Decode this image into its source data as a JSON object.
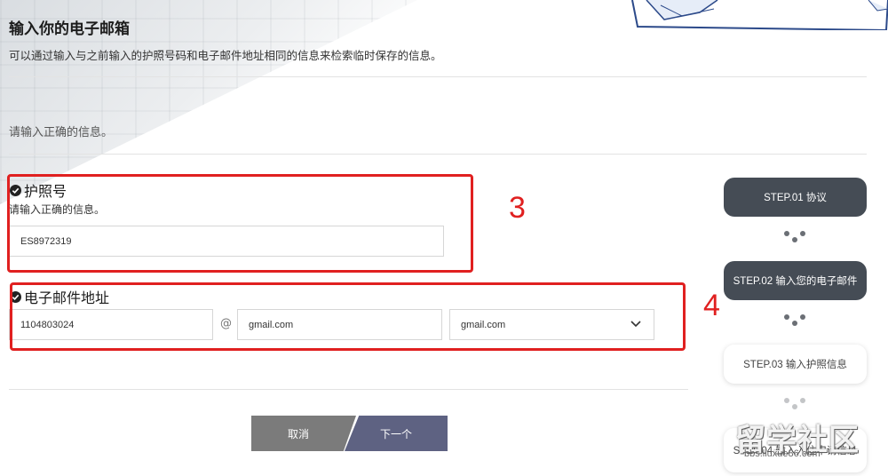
{
  "header": {
    "title": "输入你的电子邮箱",
    "description": "可以通过输入与之前输入的护照号码和电子邮件地址相同的信息来检索临时保存的信息。",
    "hint": "请输入正确的信息。"
  },
  "passport": {
    "label": "护照号",
    "sublabel": "请输入正确的信息。",
    "value": "ES8972319"
  },
  "email": {
    "label": "电子邮件地址",
    "local_part": "1104803024",
    "at": "@",
    "domain": "gmail.com",
    "domain_select": "gmail.com"
  },
  "annotations": [
    "3",
    "4"
  ],
  "buttons": {
    "cancel": "取消",
    "next": "下一个"
  },
  "steps": [
    {
      "label": "STEP.01 协议",
      "state": "active"
    },
    {
      "label": "STEP.02 输入您的电子邮件",
      "state": "active"
    },
    {
      "label": "STEP.03 输入护照信息",
      "state": "inactive"
    },
    {
      "label": "STEP.04 输入入住申请信息",
      "state": "inactive"
    }
  ],
  "watermark": {
    "text": "留学社区",
    "url": "bbs.liuxue86.com"
  },
  "colors": {
    "accent": "#454c55",
    "annotation": "#e02020",
    "next_button": "#5e6282",
    "cancel_button": "#7b7b7b"
  },
  "icons": [
    "check-circle-icon",
    "chevron-down-icon",
    "step-dots-icon"
  ]
}
